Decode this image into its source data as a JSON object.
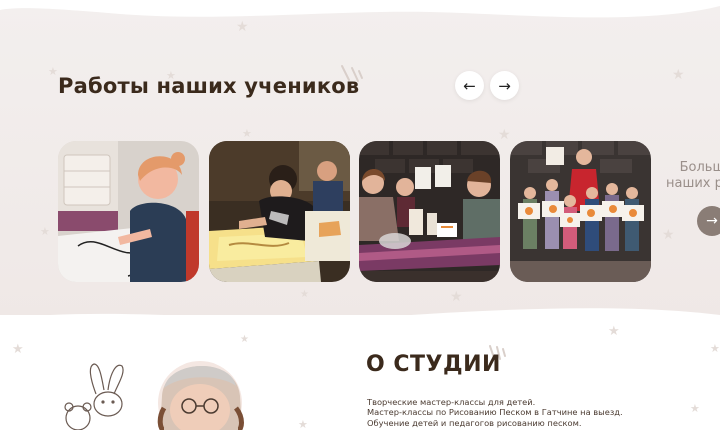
{
  "works": {
    "title": "Работы наших учеников",
    "prev_icon": "arrow-left-icon",
    "next_icon": "arrow-right-icon",
    "prev_symbol": "←",
    "next_symbol": "→",
    "more_line1": "Больше",
    "more_line2": "наших работ",
    "more_symbol": "→",
    "photos": [
      {
        "alt": "Девочка рисует на бумаге"
      },
      {
        "alt": "Рисование песком на световом столе"
      },
      {
        "alt": "Дети рисуют за столом"
      },
      {
        "alt": "Группа детей с рисунками"
      }
    ]
  },
  "about": {
    "title": "О СТУДИИ",
    "line1": "Творческие мастер-классы для детей.",
    "line2": "Мастер-классы по Рисованию Песком в Гатчине на выезд.",
    "line3": "Обучение детей и педагогов рисованию песком."
  },
  "colors": {
    "background": "#f1ecea",
    "title": "#3b2a1c",
    "nav_button": "#ffffff",
    "more_button": "#8a7d76"
  }
}
